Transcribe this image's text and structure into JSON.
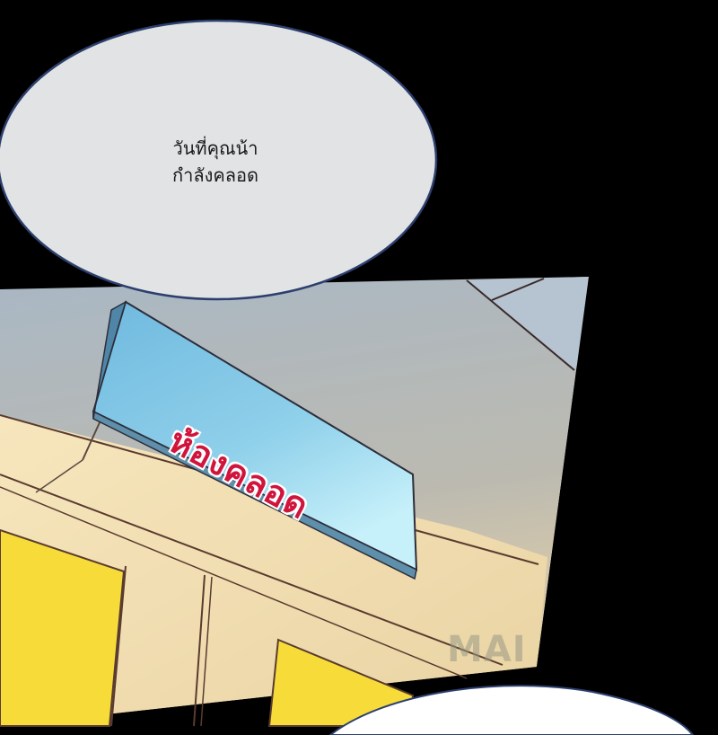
{
  "panel": {
    "speech_bubble": {
      "line1": "วันที่คุณน้า",
      "line2": "กำลังคลอด"
    },
    "sign": {
      "label": "ห้องคลอด"
    },
    "watermark": "MAI"
  },
  "colors": {
    "background": "#000000",
    "bubble_fill": "#e2e3e5",
    "bubble_stroke": "#2c3f6e",
    "sign_face": "#7ec4e6",
    "sign_text": "#d0143c",
    "wall": "#f1ddb1",
    "ceiling": "#9eaebd",
    "door": "#f7dc39"
  }
}
